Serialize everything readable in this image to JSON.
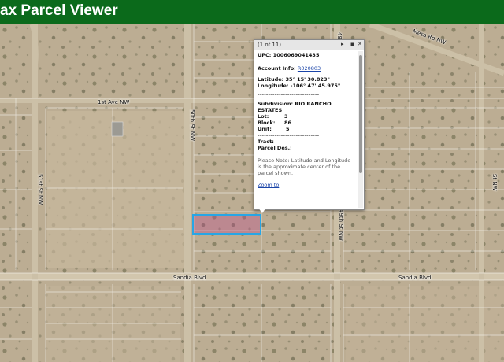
{
  "header": {
    "title": "ax Parcel Viewer"
  },
  "map": {
    "streets": {
      "first_ave": "1st Ave NW",
      "sandia_left": "Sandia Blvd",
      "sandia_right": "Sandia Blvd",
      "left_st": "51st St NW",
      "mid_st": "50th St NW",
      "right_st": "49th St NW",
      "right2_st": "48th St NW",
      "diag_rd": "Mesa Rd NW",
      "far_right": "St NW"
    },
    "colors": {
      "ground": "#b9a98f",
      "road": "#cdbfa6",
      "parcel_border": "#27a6e6",
      "parcel_fill": "#be468c"
    }
  },
  "popup": {
    "count": "(1 of 11)",
    "icons": {
      "next": "play-icon",
      "maximize": "maximize-icon",
      "close": "close-icon"
    },
    "upc": "UPC: 1006069041435",
    "account_label": "Account Info:",
    "account_link": "R020803",
    "latitude": "Latitude: 35° 15' 30.823\"",
    "longitude": "Longitude: -106° 47' 45.975\"",
    "divider1": "-----------------------------",
    "subdivision_label": "Subdivision:",
    "subdivision_value": "RIO RANCHO ESTATES",
    "lot_label": "Lot:",
    "lot_value": "3",
    "block_label": "Block:",
    "block_value": "86",
    "unit_label": "Unit:",
    "unit_value": "5",
    "divider2": "-----------------------------",
    "tract_label": "Tract:",
    "parcel_label": "Parcel Des.:",
    "note": "Please Note: Latitude and Longitude is the approximate center of the parcel shown.",
    "zoom_link": "Zoom to"
  }
}
